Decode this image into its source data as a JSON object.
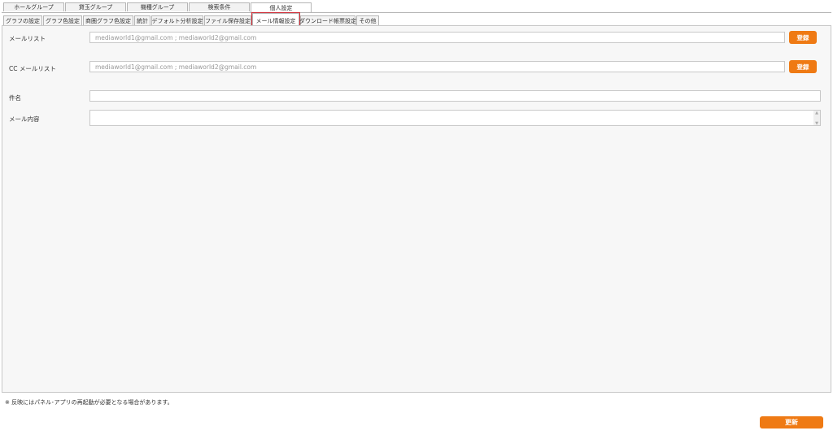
{
  "top_tabs": [
    {
      "label": "ホールグループ"
    },
    {
      "label": "貸玉グループ"
    },
    {
      "label": "機種グループ"
    },
    {
      "label": "検索条件"
    },
    {
      "label": "個人設定"
    }
  ],
  "active_top_tab": "個人設定",
  "sub_tabs": [
    {
      "label": "グラフの設定"
    },
    {
      "label": "グラフ色設定"
    },
    {
      "label": "商圏グラフ色設定"
    },
    {
      "label": "統計"
    },
    {
      "label": "デフォルト分析設定"
    },
    {
      "label": "ファイル保存設定"
    },
    {
      "label": "メール情報設定"
    },
    {
      "label": "ダウンロード帳票設定"
    },
    {
      "label": "その他"
    }
  ],
  "active_sub_tab": "メール情報設定",
  "form": {
    "mail_list_label": "メールリスト",
    "mail_list_placeholder": "mediaworld1@gmail.com ; mediaworld2@gmail.com",
    "register_label": "登録",
    "cc_mail_list_label": "CC メールリスト",
    "cc_mail_list_placeholder": "mediaworld1@gmail.com ; mediaworld2@gmail.com",
    "cc_register_label": "登録",
    "subject_label": "件名",
    "subject_value": "",
    "body_label": "メール内容",
    "body_value": ""
  },
  "note": "※ 反映にはパネル･アプリの再起動が必要となる場合があります。",
  "update_label": "更新",
  "colors": {
    "accent": "#ef7a14",
    "highlight": "#d0303a"
  }
}
